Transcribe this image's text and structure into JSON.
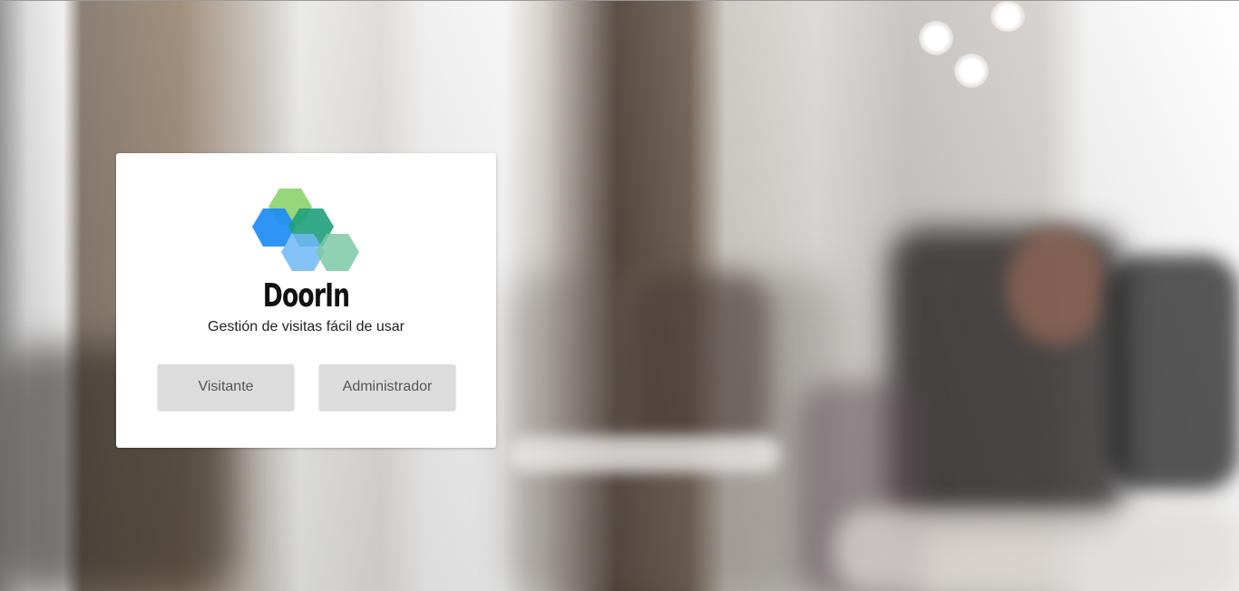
{
  "brand": {
    "name": "DoorIn",
    "tagline": "Gestión de visitas fácil de usar",
    "logo_colors": [
      "#8cd16b",
      "#1c8cf5",
      "#1fa07a",
      "#6fb9f7",
      "#7cc8a6"
    ]
  },
  "actions": {
    "visitor_label": "Visitante",
    "admin_label": "Administrador"
  }
}
